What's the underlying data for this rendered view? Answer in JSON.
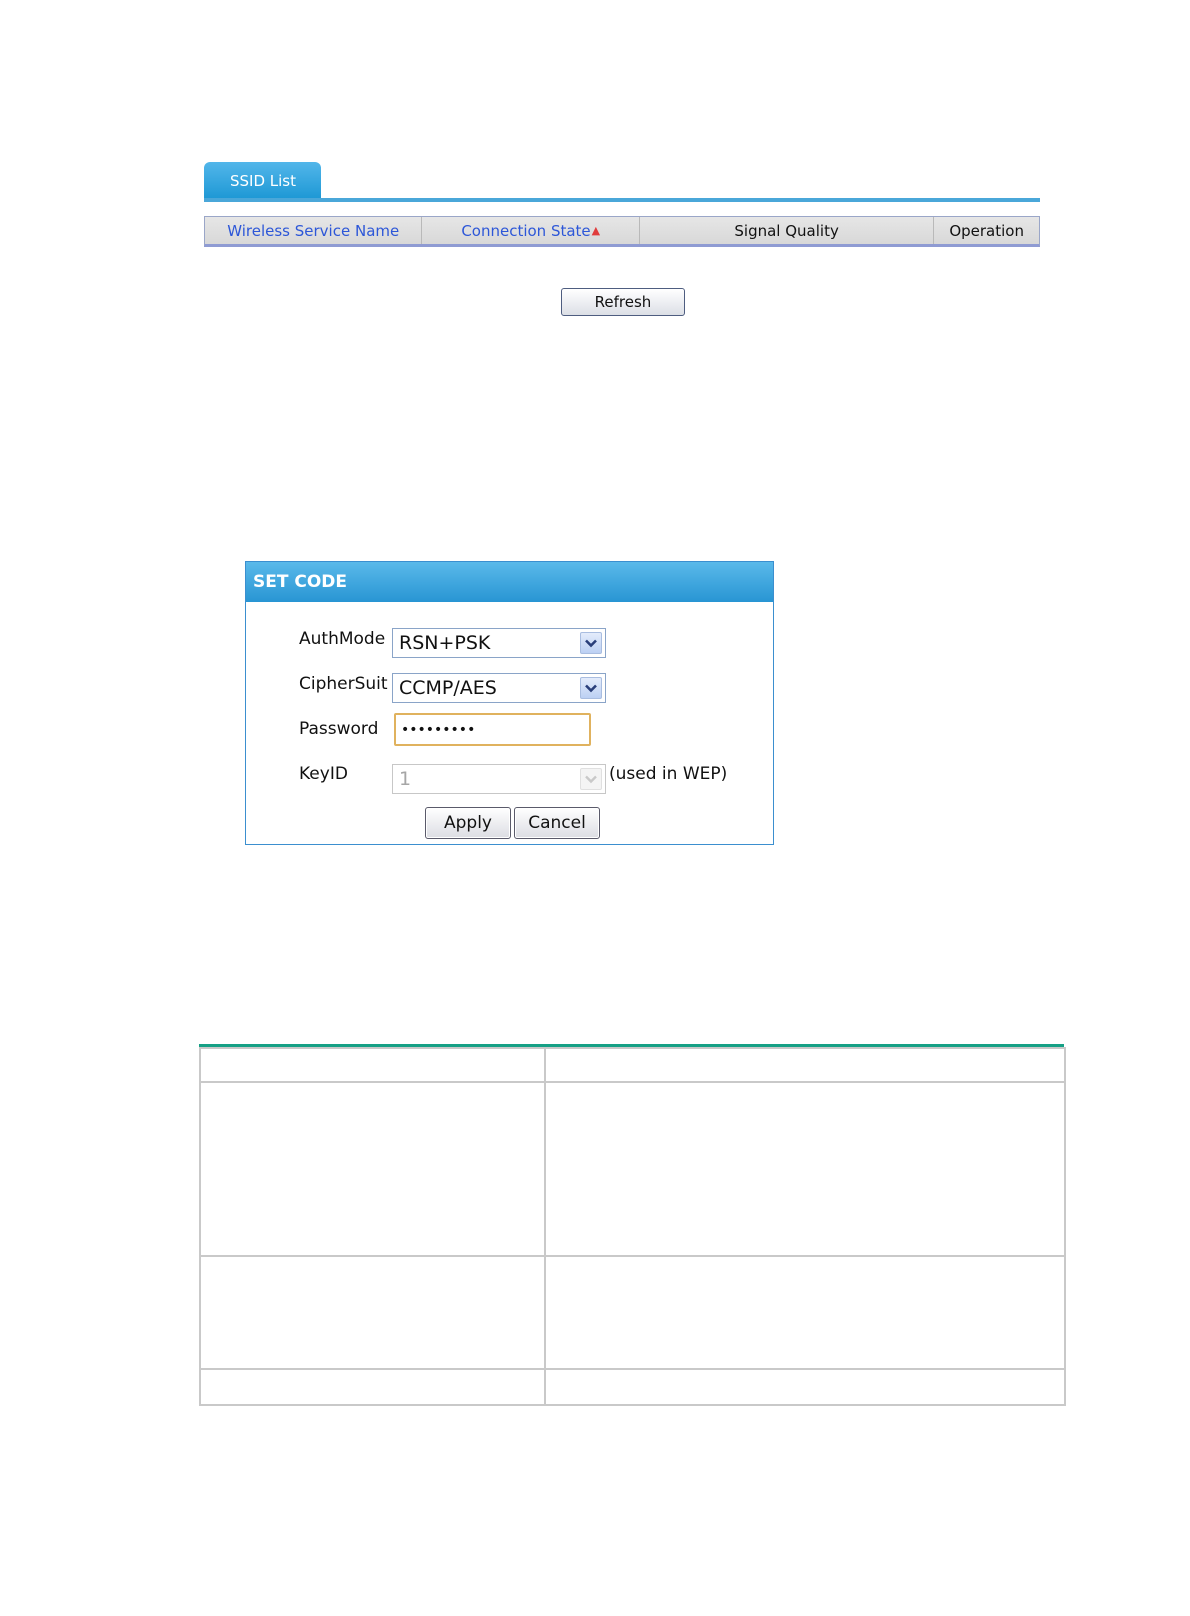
{
  "ssid_list": {
    "tab_label": "SSID List",
    "columns": [
      {
        "label": "Wireless Service Name",
        "link": true
      },
      {
        "label": "Connection State",
        "link": true,
        "sort_arrow": "up"
      },
      {
        "label": "Signal Quality",
        "link": false
      },
      {
        "label": "Operation",
        "link": false
      }
    ],
    "refresh_label": "Refresh"
  },
  "set_code": {
    "title": "SET CODE",
    "authmode": {
      "label": "AuthMode",
      "value": "RSN+PSK"
    },
    "ciphersuit": {
      "label": "CipherSuit",
      "value": "CCMP/AES"
    },
    "password": {
      "label": "Password",
      "value": "123456789"
    },
    "keyid": {
      "label": "KeyID",
      "value": "1",
      "note": "(used in WEP)",
      "disabled": true
    },
    "apply_label": "Apply",
    "cancel_label": "Cancel"
  },
  "colors": {
    "tab_blue": "#1c97d4",
    "link_blue": "#2d57d8",
    "table_rule_green": "#16a085",
    "password_focus": "#e0b25e"
  }
}
